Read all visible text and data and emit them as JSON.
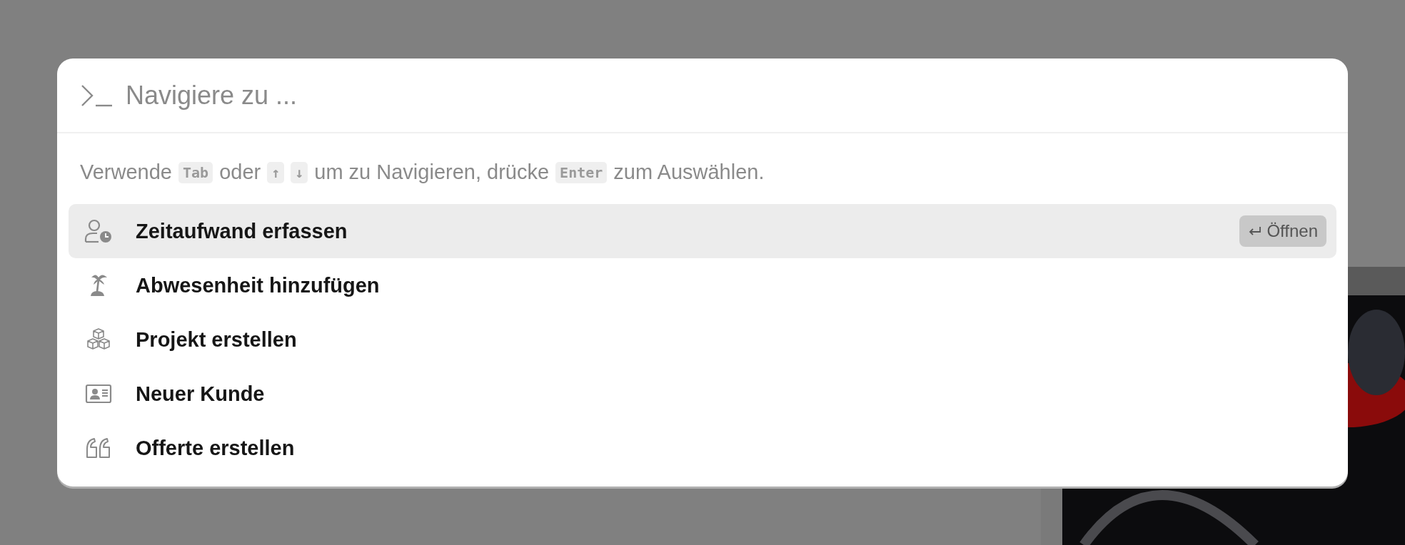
{
  "search": {
    "placeholder": "Navigiere zu ..."
  },
  "hint": [
    {
      "kind": "text",
      "text": "Verwende"
    },
    {
      "kind": "key",
      "text": "Tab"
    },
    {
      "kind": "text",
      "text": "oder"
    },
    {
      "kind": "key",
      "text": "↑"
    },
    {
      "kind": "key",
      "text": "↓"
    },
    {
      "kind": "text",
      "text": "um zu Navigieren, drücke"
    },
    {
      "kind": "key",
      "text": "Enter"
    },
    {
      "kind": "text",
      "text": "zum Auswählen."
    }
  ],
  "items": [
    {
      "label": "Zeitaufwand erfassen",
      "selected": true,
      "action": "Öffnen"
    },
    {
      "label": "Abwesenheit hinzufügen",
      "selected": false
    },
    {
      "label": "Projekt erstellen",
      "selected": false
    },
    {
      "label": "Neuer Kunde",
      "selected": false
    },
    {
      "label": "Offerte erstellen",
      "selected": false
    }
  ]
}
